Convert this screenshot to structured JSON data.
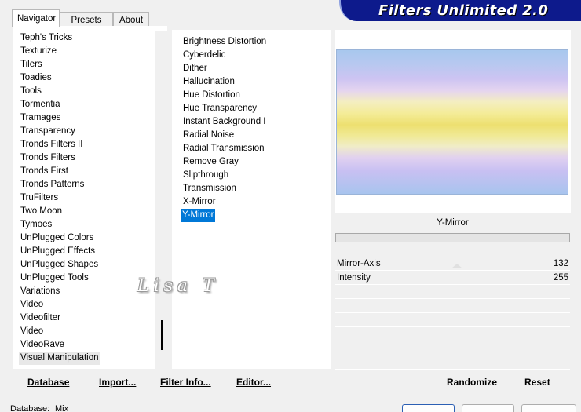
{
  "app": {
    "title": "Filters Unlimited 2.0"
  },
  "tabs": [
    {
      "label": "Navigator",
      "active": true
    },
    {
      "label": "Presets",
      "active": false
    },
    {
      "label": "About",
      "active": false
    }
  ],
  "categories": [
    "Teph's Tricks",
    "Texturize",
    "Tilers",
    "Toadies",
    "Tools",
    "Tormentia",
    "Tramages",
    "Transparency",
    "Tronds Filters II",
    "Tronds Filters",
    "Tronds First",
    "Tronds Patterns",
    "TruFilters",
    "Two Moon",
    "Tymoes",
    "UnPlugged Colors",
    "UnPlugged Effects",
    "UnPlugged Shapes",
    "UnPlugged Tools",
    "Variations",
    "Video",
    "Videofilter",
    "Video",
    "VideoRave",
    "Visual Manipulation"
  ],
  "filters": [
    "Brightness Distortion",
    "Cyberdelic",
    "Dither",
    "Hallucination",
    "Hue Distortion",
    "Hue Transparency",
    "Instant Background I",
    "Radial Noise",
    "Radial Transmission",
    "Remove Gray",
    "Slipthrough",
    "Transmission",
    "X-Mirror",
    "Y-Mirror"
  ],
  "selected_filter": "Y-Mirror",
  "params": [
    {
      "name": "Mirror-Axis",
      "value": "132"
    },
    {
      "name": "Intensity",
      "value": "255"
    }
  ],
  "buttons": {
    "database": "Database",
    "import": "Import...",
    "filter_info": "Filter Info...",
    "editor": "Editor...",
    "randomize": "Randomize",
    "reset": "Reset"
  },
  "status": {
    "label": "Database:",
    "value": "Mix"
  },
  "watermark": "Lisa T",
  "colors": {
    "banner": "#0d1a8c",
    "selection": "#0078d7"
  }
}
